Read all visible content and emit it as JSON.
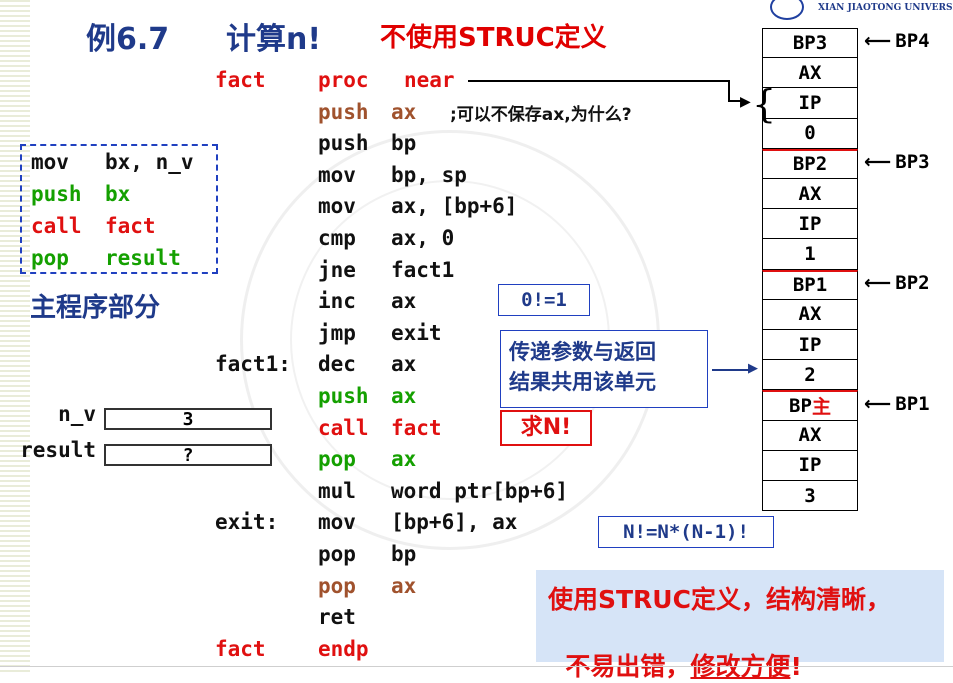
{
  "header": {
    "example": "例6.7",
    "title": "计算n!",
    "subtitle": "不使用STRUC定义",
    "logo_text": "XIAN JIAOTONG UNIVERSITY"
  },
  "main_program": {
    "lines": [
      {
        "op": "mov",
        "arg": "bx, n_v"
      },
      {
        "op": "push",
        "arg": "bx"
      },
      {
        "op": "call",
        "arg": "fact"
      },
      {
        "op": "pop",
        "arg": "result"
      }
    ],
    "caption": "主程序部分"
  },
  "variables": [
    {
      "name": "n_v",
      "value": "3"
    },
    {
      "name": "result",
      "value": "?"
    }
  ],
  "code": [
    {
      "label": "fact",
      "op": "proc",
      "arg": "near",
      "comment": ""
    },
    {
      "label": "",
      "op": "push",
      "arg": "ax",
      "comment": ";可以不保存ax,为什么?"
    },
    {
      "label": "",
      "op": "push",
      "arg": "bp",
      "comment": ""
    },
    {
      "label": "",
      "op": "mov",
      "arg": "bp, sp",
      "comment": ""
    },
    {
      "label": "",
      "op": "mov",
      "arg": "ax, [bp+6]",
      "comment": ""
    },
    {
      "label": "",
      "op": "cmp",
      "arg": "ax, 0",
      "comment": ""
    },
    {
      "label": "",
      "op": "jne",
      "arg": "fact1",
      "comment": ""
    },
    {
      "label": "",
      "op": "inc",
      "arg": "ax",
      "comment": ""
    },
    {
      "label": "",
      "op": "jmp",
      "arg": "exit",
      "comment": ""
    },
    {
      "label": "fact1:",
      "op": "dec",
      "arg": "ax",
      "comment": ""
    },
    {
      "label": "",
      "op": "push",
      "arg": "ax",
      "comment": ""
    },
    {
      "label": "",
      "op": "call",
      "arg": "fact",
      "comment": ""
    },
    {
      "label": "",
      "op": "pop",
      "arg": "ax",
      "comment": ""
    },
    {
      "label": "",
      "op": "mul",
      "arg": "word ptr[bp+6]",
      "comment": ""
    },
    {
      "label": "exit:",
      "op": "mov",
      "arg": "[bp+6], ax",
      "comment": ""
    },
    {
      "label": "",
      "op": "pop",
      "arg": "bp",
      "comment": ""
    },
    {
      "label": "",
      "op": "pop",
      "arg": "ax",
      "comment": ""
    },
    {
      "label": "",
      "op": "ret",
      "arg": "",
      "comment": ""
    },
    {
      "label": "fact",
      "op": "endp",
      "arg": "",
      "comment": ""
    }
  ],
  "notes": {
    "zero_fact": "0!=1",
    "shared_unit_line1": "传递参数与返回",
    "shared_unit_line2": "结果共用该单元",
    "find_n": "求N!",
    "formula": "N!=N*(N-1)!",
    "benefit_line1": "使用STRUC定义，结构清晰，",
    "benefit_line2_a": "不易出错，",
    "benefit_line2_b": "修改方便",
    "benefit_line2_c": "!"
  },
  "stack": [
    {
      "value": "BP3",
      "pointer": "BP4"
    },
    {
      "value": "AX",
      "pointer": ""
    },
    {
      "value": "IP",
      "pointer": ""
    },
    {
      "value": "0",
      "pointer": ""
    },
    {
      "value": "BP2",
      "pointer": "BP3"
    },
    {
      "value": "AX",
      "pointer": ""
    },
    {
      "value": "IP",
      "pointer": ""
    },
    {
      "value": "1",
      "pointer": ""
    },
    {
      "value": "BP1",
      "pointer": "BP2"
    },
    {
      "value": "AX",
      "pointer": ""
    },
    {
      "value": "IP",
      "pointer": ""
    },
    {
      "value": "2",
      "pointer": ""
    },
    {
      "value": "BP",
      "suffix": "主",
      "pointer": "BP1"
    },
    {
      "value": "AX",
      "pointer": ""
    },
    {
      "value": "IP",
      "pointer": ""
    },
    {
      "value": "3",
      "pointer": ""
    }
  ],
  "colors": {
    "title": "#1f3a8a",
    "red": "#e01010",
    "brown": "#a0522d",
    "green": "#14a000",
    "note_border": "#2040c0",
    "benefit_bg": "#d6e4f7"
  }
}
